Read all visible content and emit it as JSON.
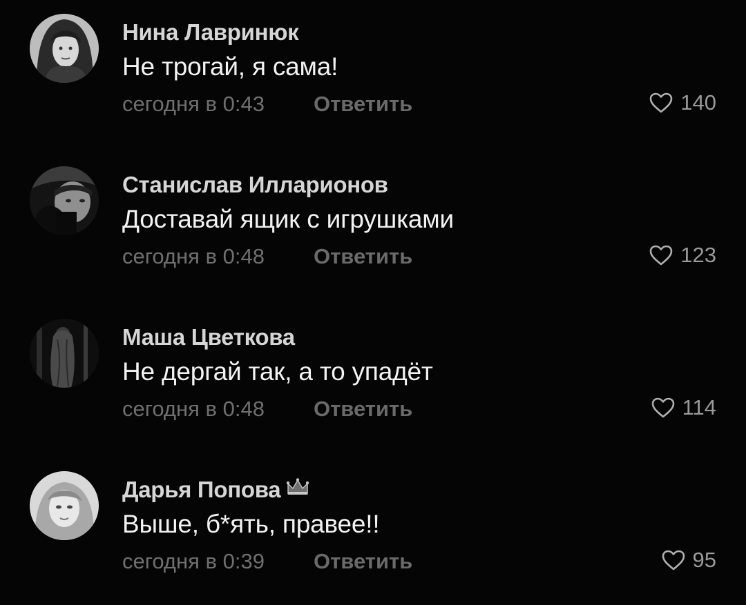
{
  "comments": [
    {
      "author": "Нина Лавринюк",
      "text": "Не трогай, я сама!",
      "time": "сегодня в 0:43",
      "reply_label": "Ответить",
      "likes": "140"
    },
    {
      "author": "Станислав Илларионов",
      "text": "Доставай ящик с игрушками",
      "time": "сегодня в 0:48",
      "reply_label": "Ответить",
      "likes": "123"
    },
    {
      "author": "Маша Цветкова",
      "text": "Не дергай так, а то упадёт",
      "time": "сегодня в 0:48",
      "reply_label": "Ответить",
      "likes": "114"
    },
    {
      "author": "Дарья Попова",
      "author_badge_icon": "crown-icon",
      "text": "Выше, б*ять, правее!!",
      "time": "сегодня в 0:39",
      "reply_label": "Ответить",
      "likes": "95"
    }
  ],
  "like_icon": "heart-outline-icon",
  "colors": {
    "background": "#050505",
    "author": "#d6d6d6",
    "text": "#f2f2f2",
    "meta": "#6f6f6f"
  }
}
